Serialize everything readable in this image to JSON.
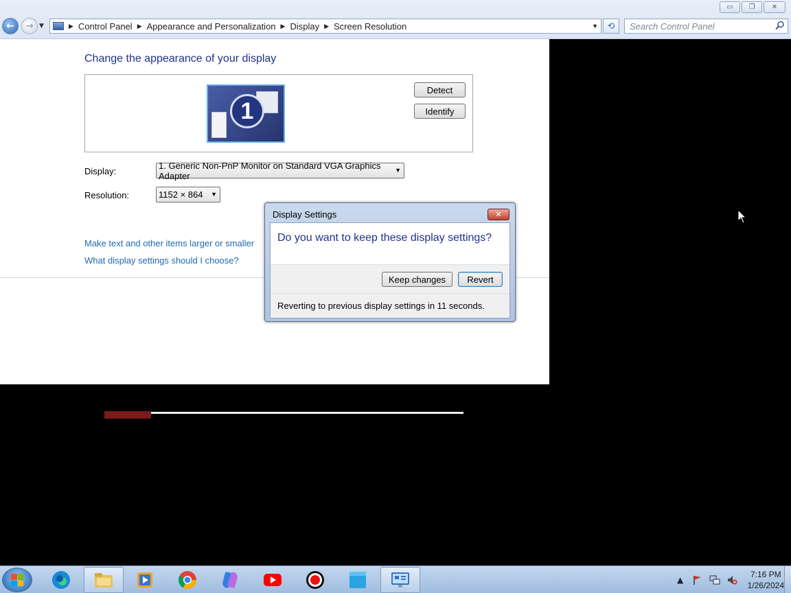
{
  "window": {
    "minimize_glyph": "▭",
    "restore_glyph": "❐",
    "close_glyph": "✕"
  },
  "address_bar": {
    "breadcrumbs": [
      "Control Panel",
      "Appearance and Personalization",
      "Display",
      "Screen Resolution"
    ]
  },
  "search": {
    "placeholder": "Search Control Panel"
  },
  "main": {
    "title": "Change the appearance of your display",
    "monitor_number": "1",
    "detect_label": "Detect",
    "identify_label": "Identify",
    "display_label": "Display:",
    "display_value": "1. Generic Non-PnP Monitor on Standard VGA Graphics Adapter",
    "resolution_label": "Resolution:",
    "resolution_value": "1152 × 864",
    "links": [
      "Make text and other items larger or smaller",
      "What display settings should I choose?"
    ]
  },
  "progress": {
    "fraction": 0.13
  },
  "dialog": {
    "title": "Display Settings",
    "question": "Do you want to keep these display settings?",
    "keep_label": "Keep changes",
    "revert_label": "Revert",
    "status": "Reverting to previous display settings in 11 seconds."
  },
  "taskbar": {
    "items": [
      {
        "icon": "edge-icon"
      },
      {
        "icon": "file-explorer-icon"
      },
      {
        "icon": "media-player-icon"
      },
      {
        "icon": "chrome-icon"
      },
      {
        "icon": "copilot-icon"
      },
      {
        "icon": "youtube-icon"
      },
      {
        "icon": "record-icon"
      },
      {
        "icon": "folder-icon"
      },
      {
        "icon": "control-panel-icon",
        "active": true
      }
    ],
    "clock_time": "7:16 PM",
    "clock_date": "1/26/2024"
  },
  "colors": {
    "title_blue": "#1e3287",
    "link_blue": "#1c6ab0",
    "progress_red": "#7a1a1a"
  }
}
